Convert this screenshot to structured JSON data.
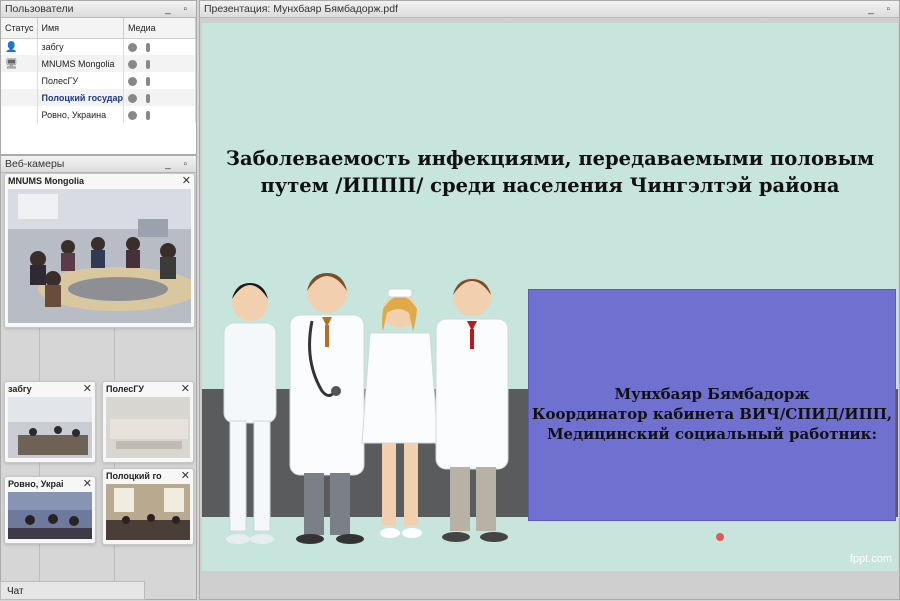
{
  "users_panel": {
    "title": "Пользователи",
    "columns": [
      "Статус",
      "Имя",
      "Медиа"
    ],
    "rows": [
      {
        "name": "забгу"
      },
      {
        "name": "MNUMS Mongolia"
      },
      {
        "name": "ПолесГУ"
      },
      {
        "name": "Полоцкий государ"
      },
      {
        "name": "Ровно, Украина"
      }
    ]
  },
  "webcams_panel": {
    "title": "Веб-камеры",
    "cams": [
      {
        "title": "MNUMS Mongolia"
      },
      {
        "title": "забгу"
      },
      {
        "title": "ПолесГУ"
      },
      {
        "title": "Полоцкий го"
      },
      {
        "title": "Ровно, Украі"
      }
    ]
  },
  "chat": {
    "label": "Чат"
  },
  "presentation": {
    "title": "Презентация: Мунхбаяр Бямбадорж.pdf",
    "slide": {
      "title_line1": "Заболеваемость инфекциями, передаваемыми половым",
      "title_line2": "путем /ИППП/ среди населения Чингэлтэй района",
      "author_line1": "Мунхбаяр Бямбадорж",
      "author_line2": "Координатор кабинета ВИЧ/СПИД/ИПП,",
      "author_line3": "Медицинский социальный работник:",
      "watermark": "fppt.com"
    }
  },
  "colors": {
    "slide_bg": "#c7e4dd",
    "purple_box": "#7070d0",
    "band": "#5a5b5c"
  }
}
